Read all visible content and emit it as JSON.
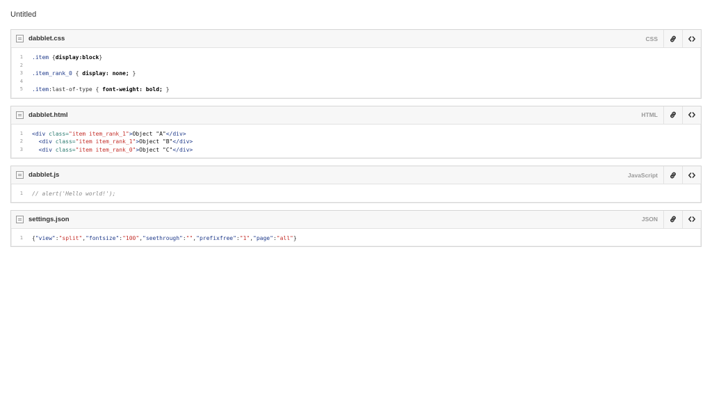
{
  "page": {
    "title": "Untitled"
  },
  "files": [
    {
      "name": "dabblet.css",
      "lang": "CSS",
      "lines": [
        {
          "n": "1",
          "parts": [
            {
              "t": ".item",
              "c": "sel"
            },
            {
              "t": " {",
              "c": "pun"
            },
            {
              "t": "display:block",
              "c": "kw"
            },
            {
              "t": "}",
              "c": "pun"
            }
          ]
        },
        {
          "n": "2",
          "parts": []
        },
        {
          "n": "3",
          "parts": [
            {
              "t": ".item_rank_0",
              "c": "sel"
            },
            {
              "t": " { ",
              "c": "pun"
            },
            {
              "t": "display: none;",
              "c": "kw"
            },
            {
              "t": " }",
              "c": "pun"
            }
          ]
        },
        {
          "n": "4",
          "parts": []
        },
        {
          "n": "5",
          "parts": [
            {
              "t": ".item",
              "c": "sel"
            },
            {
              "t": ":last-of-type { ",
              "c": "pun"
            },
            {
              "t": "font-weight: bold;",
              "c": "kw"
            },
            {
              "t": " }",
              "c": "pun"
            }
          ]
        }
      ]
    },
    {
      "name": "dabblet.html",
      "lang": "HTML",
      "lines": [
        {
          "n": "1",
          "parts": [
            {
              "t": "<div ",
              "c": "tag"
            },
            {
              "t": "class=",
              "c": "attr"
            },
            {
              "t": "\"item item_rank_1\"",
              "c": "str"
            },
            {
              "t": ">",
              "c": "tag"
            },
            {
              "t": "Object \"A\"",
              "c": "src"
            },
            {
              "t": "</div>",
              "c": "tag"
            }
          ]
        },
        {
          "n": "2",
          "parts": [
            {
              "t": "  <div ",
              "c": "tag"
            },
            {
              "t": "class=",
              "c": "attr"
            },
            {
              "t": "\"item item_rank_1\"",
              "c": "str"
            },
            {
              "t": ">",
              "c": "tag"
            },
            {
              "t": "Object \"B\"",
              "c": "src"
            },
            {
              "t": "</div>",
              "c": "tag"
            }
          ]
        },
        {
          "n": "3",
          "parts": [
            {
              "t": "  <div ",
              "c": "tag"
            },
            {
              "t": "class=",
              "c": "attr"
            },
            {
              "t": "\"item item_rank_0\"",
              "c": "str"
            },
            {
              "t": ">",
              "c": "tag"
            },
            {
              "t": "Object \"C\"",
              "c": "src"
            },
            {
              "t": "</div>",
              "c": "tag"
            }
          ]
        }
      ]
    },
    {
      "name": "dabblet.js",
      "lang": "JavaScript",
      "lines": [
        {
          "n": "1",
          "parts": [
            {
              "t": "// alert('Hello world!');",
              "c": "cmt"
            }
          ]
        }
      ]
    },
    {
      "name": "settings.json",
      "lang": "JSON",
      "lines": [
        {
          "n": "1",
          "parts": [
            {
              "t": "{",
              "c": "pun"
            },
            {
              "t": "\"view\"",
              "c": "tag"
            },
            {
              "t": ":",
              "c": "pun"
            },
            {
              "t": "\"split\"",
              "c": "str"
            },
            {
              "t": ",",
              "c": "pun"
            },
            {
              "t": "\"fontsize\"",
              "c": "tag"
            },
            {
              "t": ":",
              "c": "pun"
            },
            {
              "t": "\"100\"",
              "c": "str"
            },
            {
              "t": ",",
              "c": "pun"
            },
            {
              "t": "\"seethrough\"",
              "c": "tag"
            },
            {
              "t": ":",
              "c": "pun"
            },
            {
              "t": "\"\"",
              "c": "str"
            },
            {
              "t": ",",
              "c": "pun"
            },
            {
              "t": "\"prefixfree\"",
              "c": "tag"
            },
            {
              "t": ":",
              "c": "pun"
            },
            {
              "t": "\"1\"",
              "c": "str"
            },
            {
              "t": ",",
              "c": "pun"
            },
            {
              "t": "\"page\"",
              "c": "tag"
            },
            {
              "t": ":",
              "c": "pun"
            },
            {
              "t": "\"all\"",
              "c": "str"
            },
            {
              "t": "}",
              "c": "pun"
            }
          ]
        }
      ]
    }
  ],
  "icons": {
    "file": "file-icon",
    "link": "link-icon",
    "embed": "code-icon"
  }
}
